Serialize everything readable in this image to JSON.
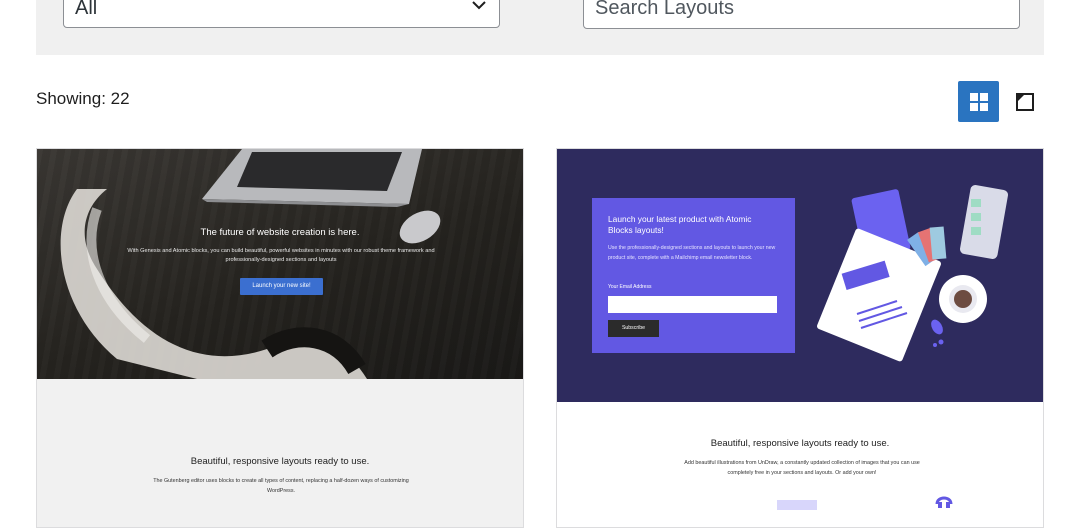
{
  "filters": {
    "category_value": "All",
    "search_placeholder": "Search Layouts"
  },
  "results": {
    "showing_label": "Showing: 22"
  },
  "view": {
    "active": "grid"
  },
  "colors": {
    "accent": "#2a74c0",
    "filter_bg": "#f0f0f0",
    "card2_hero": "#2e2b5e",
    "card2_box": "#6258e3"
  },
  "layouts": [
    {
      "hero_title": "The future of website creation is here.",
      "hero_text": "With Genesis and Atomic blocks, you can build beautiful, powerful websites in minutes with our robust theme framework and professionally-designed sections and layouts",
      "hero_button": "Launch your new site!",
      "section_title": "Beautiful, responsive layouts ready to use.",
      "section_text": "The Gutenberg editor uses blocks to create all types of content, replacing a half-dozen ways of customizing WordPress."
    },
    {
      "hero_title": "Launch your latest product with Atomic Blocks layouts!",
      "hero_text": "Use the professionally-designed sections and layouts to launch your new product site, complete with a Mailchimp email newsletter block.",
      "email_label": "Your Email Address",
      "hero_button": "Subscribe",
      "section_title": "Beautiful, responsive layouts ready to use.",
      "section_text": "Add beautiful illustrations from UnDraw, a constantly updated collection of images that you can use completely free in your sections and layouts. Or add your own!"
    }
  ]
}
